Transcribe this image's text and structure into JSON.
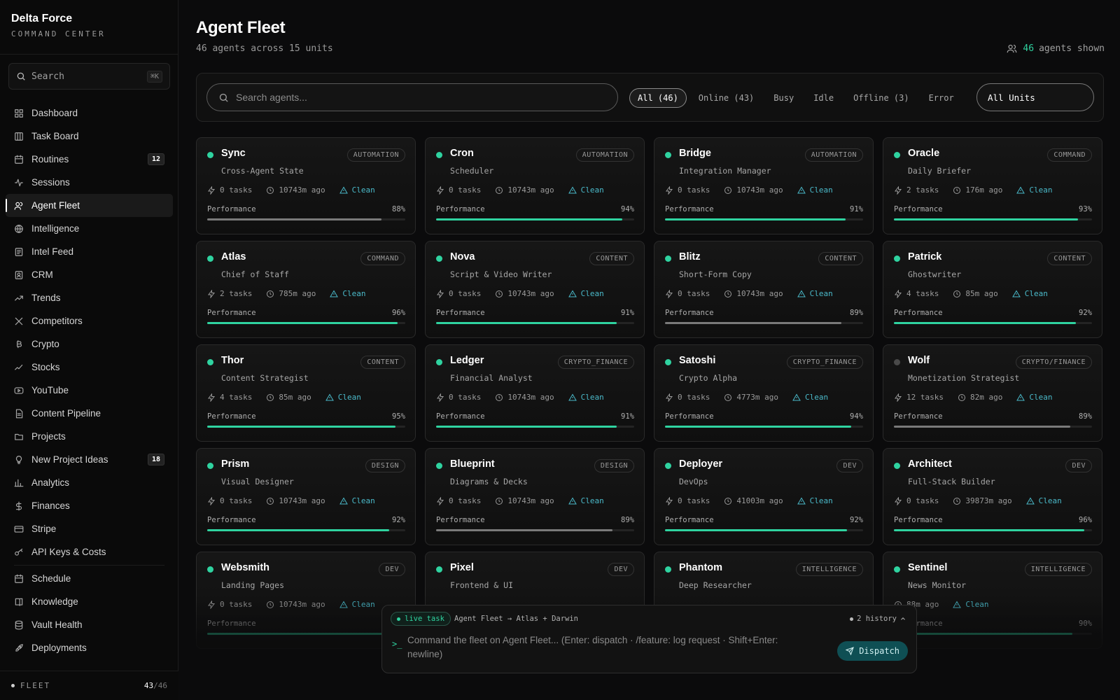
{
  "brand": {
    "title": "Delta Force",
    "subtitle": "COMMAND CENTER"
  },
  "sidebar": {
    "search_placeholder": "Search",
    "search_shortcut": "⌘K",
    "items": [
      {
        "label": "Dashboard",
        "icon": "dashboard-icon"
      },
      {
        "label": "Task Board",
        "icon": "kanban-icon"
      },
      {
        "label": "Routines",
        "icon": "routines-icon",
        "badge": "12"
      },
      {
        "label": "Sessions",
        "icon": "activity-icon"
      },
      {
        "label": "Agent Fleet",
        "icon": "users-icon",
        "active": true
      },
      {
        "label": "Intelligence",
        "icon": "globe-icon"
      },
      {
        "label": "Intel Feed",
        "icon": "feed-icon"
      },
      {
        "label": "CRM",
        "icon": "contacts-icon"
      },
      {
        "label": "Trends",
        "icon": "trending-up-icon"
      },
      {
        "label": "Competitors",
        "icon": "swords-icon"
      },
      {
        "label": "Crypto",
        "icon": "bitcoin-icon"
      },
      {
        "label": "Stocks",
        "icon": "chart-icon"
      },
      {
        "label": "YouTube",
        "icon": "youtube-icon"
      },
      {
        "label": "Content Pipeline",
        "icon": "document-icon"
      },
      {
        "label": "Projects",
        "icon": "folder-icon"
      },
      {
        "label": "New Project Ideas",
        "icon": "lightbulb-icon",
        "badge": "18"
      },
      {
        "label": "Analytics",
        "icon": "bar-chart-icon"
      },
      {
        "label": "Finances",
        "icon": "dollar-icon"
      },
      {
        "label": "Stripe",
        "icon": "credit-card-icon"
      },
      {
        "label": "API Keys & Costs",
        "icon": "key-icon"
      },
      {
        "label": "Schedule",
        "icon": "calendar-icon"
      },
      {
        "label": "Knowledge",
        "icon": "book-icon"
      },
      {
        "label": "Vault Health",
        "icon": "database-icon"
      },
      {
        "label": "Deployments",
        "icon": "rocket-icon"
      }
    ],
    "footer": {
      "label": "FLEET",
      "online": "43",
      "total": "/46"
    }
  },
  "header": {
    "title": "Agent Fleet",
    "subtitle": "46 agents across 15 units",
    "shown_count": "46",
    "shown_label": "agents shown"
  },
  "filters": {
    "search_placeholder": "Search agents...",
    "chips": [
      "All (46)",
      "Online (43)",
      "Busy",
      "Idle",
      "Offline (3)",
      "Error"
    ],
    "active_chip": 0,
    "units_label": "All Units"
  },
  "perf_label": "Performance",
  "agents": [
    {
      "name": "Sync",
      "unit": "AUTOMATION",
      "role": "Cross-Agent State",
      "tasks": "0 tasks",
      "ago": "10743m ago",
      "status_text": "Clean",
      "perf": "88%",
      "perf_value": 88,
      "online": true,
      "bar": "gray"
    },
    {
      "name": "Cron",
      "unit": "AUTOMATION",
      "role": "Scheduler",
      "tasks": "0 tasks",
      "ago": "10743m ago",
      "status_text": "Clean",
      "perf": "94%",
      "perf_value": 94,
      "online": true,
      "bar": "green"
    },
    {
      "name": "Bridge",
      "unit": "AUTOMATION",
      "role": "Integration Manager",
      "tasks": "0 tasks",
      "ago": "10743m ago",
      "status_text": "Clean",
      "perf": "91%",
      "perf_value": 91,
      "online": true,
      "bar": "green"
    },
    {
      "name": "Oracle",
      "unit": "COMMAND",
      "role": "Daily Briefer",
      "tasks": "2 tasks",
      "ago": "176m ago",
      "status_text": "Clean",
      "perf": "93%",
      "perf_value": 93,
      "online": true,
      "bar": "green"
    },
    {
      "name": "Atlas",
      "unit": "COMMAND",
      "role": "Chief of Staff",
      "tasks": "2 tasks",
      "ago": "785m ago",
      "status_text": "Clean",
      "perf": "96%",
      "perf_value": 96,
      "online": true,
      "bar": "green"
    },
    {
      "name": "Nova",
      "unit": "CONTENT",
      "role": "Script & Video Writer",
      "tasks": "0 tasks",
      "ago": "10743m ago",
      "status_text": "Clean",
      "perf": "91%",
      "perf_value": 91,
      "online": true,
      "bar": "green"
    },
    {
      "name": "Blitz",
      "unit": "CONTENT",
      "role": "Short-Form Copy",
      "tasks": "0 tasks",
      "ago": "10743m ago",
      "status_text": "Clean",
      "perf": "89%",
      "perf_value": 89,
      "online": true,
      "bar": "gray"
    },
    {
      "name": "Patrick",
      "unit": "CONTENT",
      "role": "Ghostwriter",
      "tasks": "4 tasks",
      "ago": "85m ago",
      "status_text": "Clean",
      "perf": "92%",
      "perf_value": 92,
      "online": true,
      "bar": "green"
    },
    {
      "name": "Thor",
      "unit": "CONTENT",
      "role": "Content Strategist",
      "tasks": "4 tasks",
      "ago": "85m ago",
      "status_text": "Clean",
      "perf": "95%",
      "perf_value": 95,
      "online": true,
      "bar": "green"
    },
    {
      "name": "Ledger",
      "unit": "CRYPTO_FINANCE",
      "role": "Financial Analyst",
      "tasks": "0 tasks",
      "ago": "10743m ago",
      "status_text": "Clean",
      "perf": "91%",
      "perf_value": 91,
      "online": true,
      "bar": "green"
    },
    {
      "name": "Satoshi",
      "unit": "CRYPTO_FINANCE",
      "role": "Crypto Alpha",
      "tasks": "0 tasks",
      "ago": "4773m ago",
      "status_text": "Clean",
      "perf": "94%",
      "perf_value": 94,
      "online": true,
      "bar": "green"
    },
    {
      "name": "Wolf",
      "unit": "CRYPTO/FINANCE",
      "role": "Monetization Strategist",
      "tasks": "12 tasks",
      "ago": "82m ago",
      "status_text": "Clean",
      "perf": "89%",
      "perf_value": 89,
      "online": false,
      "bar": "gray"
    },
    {
      "name": "Prism",
      "unit": "DESIGN",
      "role": "Visual Designer",
      "tasks": "0 tasks",
      "ago": "10743m ago",
      "status_text": "Clean",
      "perf": "92%",
      "perf_value": 92,
      "online": true,
      "bar": "green"
    },
    {
      "name": "Blueprint",
      "unit": "DESIGN",
      "role": "Diagrams & Decks",
      "tasks": "0 tasks",
      "ago": "10743m ago",
      "status_text": "Clean",
      "perf": "89%",
      "perf_value": 89,
      "online": true,
      "bar": "gray"
    },
    {
      "name": "Deployer",
      "unit": "DEV",
      "role": "DevOps",
      "tasks": "0 tasks",
      "ago": "41003m ago",
      "status_text": "Clean",
      "perf": "92%",
      "perf_value": 92,
      "online": true,
      "bar": "green"
    },
    {
      "name": "Architect",
      "unit": "DEV",
      "role": "Full-Stack Builder",
      "tasks": "0 tasks",
      "ago": "39873m ago",
      "status_text": "Clean",
      "perf": "96%",
      "perf_value": 96,
      "online": true,
      "bar": "green"
    },
    {
      "name": "Websmith",
      "unit": "DEV",
      "role": "Landing Pages",
      "tasks": "0 tasks",
      "ago": "10743m ago",
      "status_text": "Clean",
      "perf": "",
      "perf_value": 90,
      "online": true,
      "bar": "green"
    },
    {
      "name": "Pixel",
      "unit": "DEV",
      "role": "Frontend & UI",
      "tasks": "",
      "ago": "",
      "status_text": "",
      "perf": "",
      "perf_value": 90,
      "online": true,
      "bar": "green"
    },
    {
      "name": "Phantom",
      "unit": "INTELLIGENCE",
      "role": "Deep Researcher",
      "tasks": "",
      "ago": "",
      "status_text": "",
      "perf": "",
      "perf_value": 90,
      "online": true,
      "bar": "green"
    },
    {
      "name": "Sentinel",
      "unit": "INTELLIGENCE",
      "role": "News Monitor",
      "tasks": "",
      "ago": "88m ago",
      "status_text": "Clean",
      "perf": "90%",
      "perf_value": 90,
      "online": true,
      "bar": "green"
    }
  ],
  "command": {
    "live_label": "live task",
    "route": "Agent Fleet → Atlas + Darwin",
    "history": "2 history",
    "prompt_symbol": ">_",
    "placeholder": "Command the fleet on Agent Fleet...  (Enter: dispatch · /feature: log request · Shift+Enter: newline)",
    "dispatch_label": "Dispatch"
  },
  "colors": {
    "accent": "#2fd3a0",
    "clean": "#4ab9c9",
    "bar_gray": "#7a7a7a",
    "dispatch_bg": "#0f4f54"
  }
}
